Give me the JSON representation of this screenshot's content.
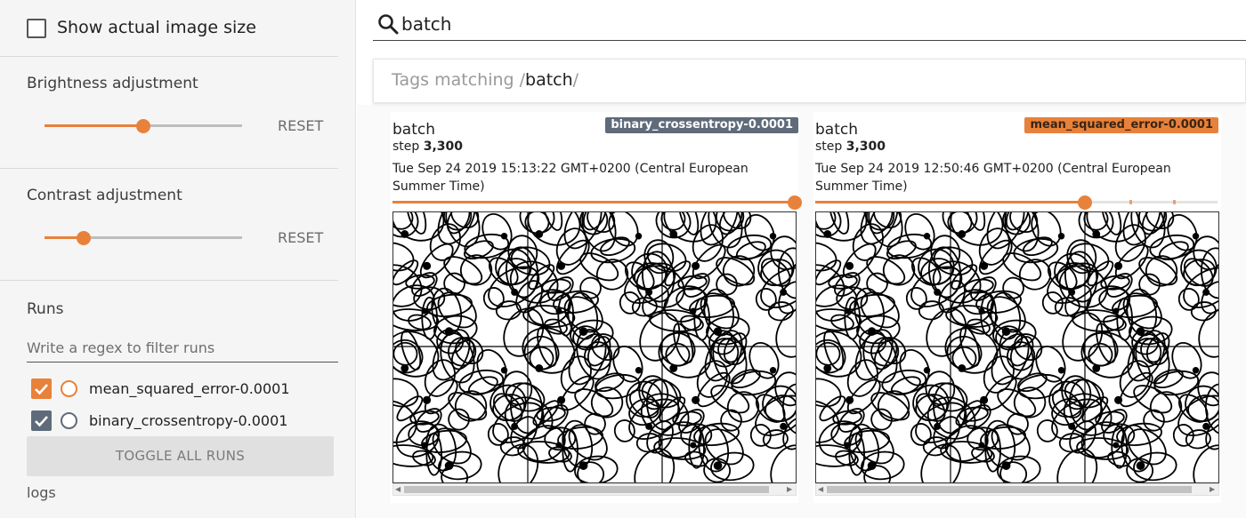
{
  "sidebar": {
    "show_actual_size": {
      "label": "Show actual image size",
      "checked": false
    },
    "brightness": {
      "title": "Brightness adjustment",
      "value": 0.5,
      "reset_label": "RESET"
    },
    "contrast": {
      "title": "Contrast adjustment",
      "value": 0.2,
      "reset_label": "RESET"
    },
    "runs": {
      "title": "Runs",
      "filter_placeholder": "Write a regex to filter runs",
      "items": [
        {
          "label": "mean_squared_error-0.0001",
          "checked": true,
          "color": "#e8813a"
        },
        {
          "label": "binary_crossentropy-0.0001",
          "checked": true,
          "color": "#5f6b7a"
        }
      ],
      "toggle_all_label": "TOGGLE ALL RUNS",
      "logs_label": "logs"
    }
  },
  "search": {
    "value": "batch",
    "icon": "search-icon"
  },
  "tags_bar": {
    "prefix": "Tags matching /",
    "pattern": "batch",
    "suffix": "/"
  },
  "cards": [
    {
      "tag": "batch",
      "run": "binary_crossentropy-0.0001",
      "run_color": "#5f6b7a",
      "step_label": "step",
      "step": "3,300",
      "timestamp": "Tue Sep 24 2019 15:13:22 GMT+0200 (Central European Summer Time)",
      "step_position": 1.0
    },
    {
      "tag": "batch",
      "run": "mean_squared_error-0.0001",
      "run_color": "#e8813a",
      "step_label": "step",
      "step": "3,300",
      "timestamp": "Tue Sep 24 2019 12:50:46 GMT+0200 (Central European Summer Time)",
      "step_position": 0.67
    }
  ],
  "colors": {
    "accent": "#e8813a",
    "sidebar_bg": "#f5f5f5"
  }
}
